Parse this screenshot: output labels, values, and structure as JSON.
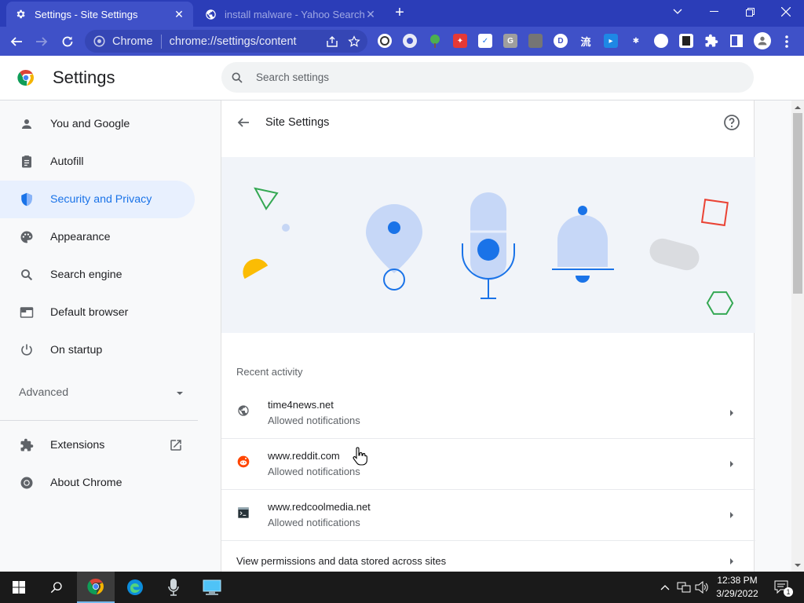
{
  "browser": {
    "tabs": [
      {
        "title": "Settings - Site Settings",
        "active": true
      },
      {
        "title": "install malware - Yahoo Search",
        "active": false
      }
    ],
    "new_tab_label": "+",
    "omnibox": {
      "chip_label": "Chrome",
      "url": "chrome://settings/content"
    },
    "accent": "#3f51c8"
  },
  "settings": {
    "title": "Settings",
    "search_placeholder": "Search settings"
  },
  "sidebar": {
    "items": [
      {
        "label": "You and Google",
        "icon": "person-icon"
      },
      {
        "label": "Autofill",
        "icon": "clipboard-icon"
      },
      {
        "label": "Security and Privacy",
        "icon": "shield-icon",
        "selected": true
      },
      {
        "label": "Appearance",
        "icon": "palette-icon"
      },
      {
        "label": "Search engine",
        "icon": "search-icon"
      },
      {
        "label": "Default browser",
        "icon": "browser-window-icon"
      },
      {
        "label": "On startup",
        "icon": "power-icon"
      }
    ],
    "advanced_label": "Advanced",
    "bottom_items": [
      {
        "label": "Extensions",
        "icon": "puzzle-icon"
      },
      {
        "label": "About Chrome",
        "icon": "chrome-icon"
      }
    ]
  },
  "main": {
    "title": "Site Settings",
    "recent_activity_label": "Recent activity",
    "activity": [
      {
        "site": "time4news.net",
        "detail": "Allowed notifications",
        "icon": "globe-icon"
      },
      {
        "site": "www.reddit.com",
        "detail": "Allowed notifications",
        "icon": "reddit-icon"
      },
      {
        "site": "www.redcoolmedia.net",
        "detail": "Allowed notifications",
        "icon": "terminal-icon"
      }
    ],
    "view_permissions_label": "View permissions and data stored across sites"
  },
  "taskbar": {
    "time": "12:38 PM",
    "date": "3/29/2022",
    "notification_count": "1"
  }
}
